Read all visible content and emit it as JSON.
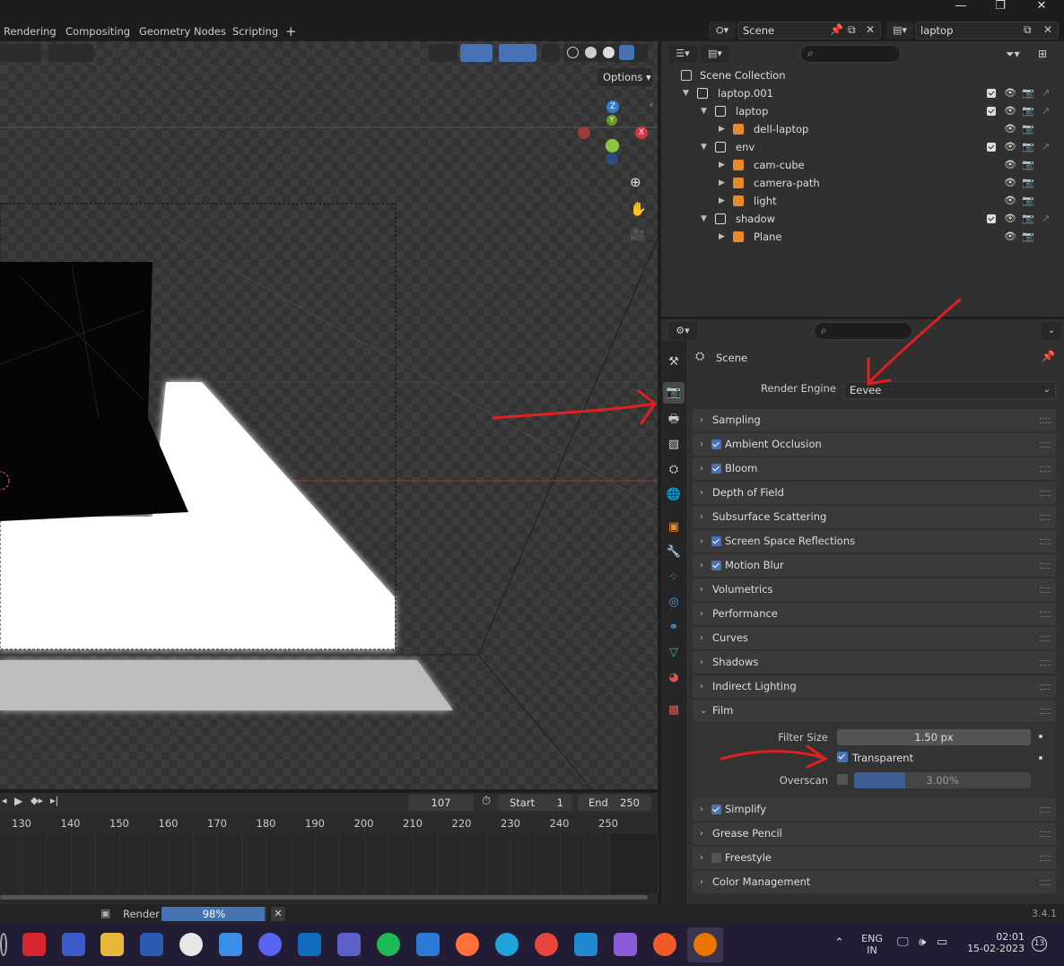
{
  "menubar": {
    "workspace_tabs": [
      "Rendering",
      "Compositing",
      "Geometry Nodes",
      "Scripting"
    ],
    "add_tab": "+",
    "scene_name": "Scene",
    "view_layer": "laptop"
  },
  "viewport": {
    "options_label": "Options",
    "gizmo_axes": {
      "z": "Z",
      "x": "X",
      "y": "Y"
    }
  },
  "outliner": {
    "root": "Scene Collection",
    "rows": [
      {
        "label": "laptop.001"
      },
      {
        "label": "laptop"
      },
      {
        "label": "dell-laptop"
      },
      {
        "label": "env"
      },
      {
        "label": "cam-cube"
      },
      {
        "label": "camera-path"
      },
      {
        "label": "light"
      },
      {
        "label": "shadow"
      },
      {
        "label": "Plane"
      }
    ]
  },
  "properties": {
    "context_title": "Scene",
    "render_engine_label": "Render Engine",
    "render_engine_value": "Eevee",
    "sections": [
      {
        "label": "Sampling",
        "checkbox": null
      },
      {
        "label": "Ambient Occlusion",
        "checkbox": true
      },
      {
        "label": "Bloom",
        "checkbox": true
      },
      {
        "label": "Depth of Field",
        "checkbox": null
      },
      {
        "label": "Subsurface Scattering",
        "checkbox": null
      },
      {
        "label": "Screen Space Reflections",
        "checkbox": true
      },
      {
        "label": "Motion Blur",
        "checkbox": true
      },
      {
        "label": "Volumetrics",
        "checkbox": null
      },
      {
        "label": "Performance",
        "checkbox": null
      },
      {
        "label": "Curves",
        "checkbox": null
      },
      {
        "label": "Shadows",
        "checkbox": null
      },
      {
        "label": "Indirect Lighting",
        "checkbox": null
      }
    ],
    "film": {
      "label": "Film",
      "filter_size_label": "Filter Size",
      "filter_size_value": "1.50 px",
      "transparent_label": "Transparent",
      "transparent_checked": true,
      "overscan_label": "Overscan",
      "overscan_value": "3.00%"
    },
    "sections_after": [
      {
        "label": "Simplify",
        "checkbox": true
      },
      {
        "label": "Grease Pencil",
        "checkbox": null
      },
      {
        "label": "Freestyle",
        "checkbox": false
      },
      {
        "label": "Color Management",
        "checkbox": null
      }
    ]
  },
  "timeline": {
    "current_frame": "107",
    "start_label": "Start",
    "start_value": "1",
    "end_label": "End",
    "end_value": "250",
    "ruler": [
      "130",
      "140",
      "150",
      "160",
      "170",
      "180",
      "190",
      "200",
      "210",
      "220",
      "230",
      "240",
      "250"
    ]
  },
  "statusbar": {
    "render_label": "Render",
    "render_progress": "98%",
    "render_fraction": 0.98,
    "version": "3.4.1"
  },
  "taskbar": {
    "lang_top": "ENG",
    "lang_bottom": "IN",
    "time": "02:01",
    "date": "15-02-2023",
    "notifications": "13"
  },
  "colors": {
    "accent": "#4772b3",
    "annotation_red": "#e02020",
    "panel": "#303030",
    "viewport": "#393939"
  }
}
